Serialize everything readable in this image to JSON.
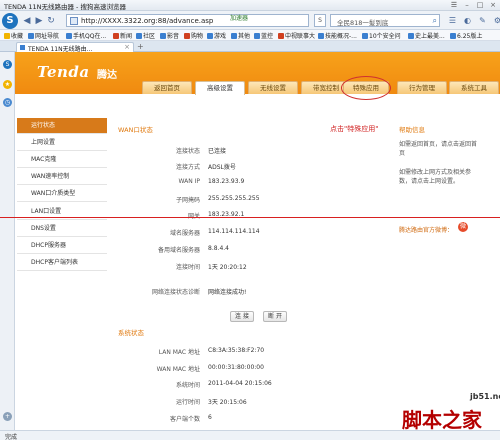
{
  "window": {
    "title": "TENDA 11N无线路由器 - 搜狗高速浏览器"
  },
  "address": {
    "url": "http://XXXX.3322.org:88/advance.asp",
    "accel_label": "加速器",
    "search_value": "全民818一髪到底"
  },
  "favorites": [
    {
      "label": "收藏",
      "color": "#f1b400"
    },
    {
      "label": "网址导航",
      "color": "#3a7fd0"
    },
    {
      "label": "手机QQ在...",
      "color": "#3a7fd0"
    },
    {
      "label": "新闻",
      "color": "#d04020"
    },
    {
      "label": "社区",
      "color": "#3a7fd0"
    },
    {
      "label": "影音",
      "color": "#3a7fd0"
    },
    {
      "label": "购物",
      "color": "#d04020"
    },
    {
      "label": "游戏",
      "color": "#3a7fd0"
    },
    {
      "label": "其他",
      "color": "#3a7fd0"
    },
    {
      "label": "蓝控",
      "color": "#3a7fd0"
    },
    {
      "label": "中视联事大",
      "color": "#d04020"
    },
    {
      "label": "技能概况-...",
      "color": "#3a7fd0"
    },
    {
      "label": "10个安全问",
      "color": "#3a7fd0"
    },
    {
      "label": "史上最美...",
      "color": "#3a7fd0"
    },
    {
      "label": "6.25版上",
      "color": "#3a7fd0"
    }
  ],
  "tab": {
    "label": "TENDA 11N无线路由..."
  },
  "status": {
    "text": "完成"
  },
  "router": {
    "brand": "Tenda",
    "brand_cn": "腾达",
    "tabs": [
      {
        "label": "返回首页",
        "active": false
      },
      {
        "label": "高级设置",
        "active": true
      },
      {
        "label": "无线设置",
        "active": false
      },
      {
        "label": "带宽控制",
        "active": false
      },
      {
        "label": "特殊应用",
        "active": false
      },
      {
        "label": "行为管理",
        "active": false
      },
      {
        "label": "系统工具",
        "active": false
      }
    ],
    "left_nav": [
      {
        "label": "运行状态",
        "active": true
      },
      {
        "label": "上网设置",
        "active": false
      },
      {
        "label": "MAC克隆",
        "active": false
      },
      {
        "label": "WAN速率控制",
        "active": false
      },
      {
        "label": "WAN口介质类型",
        "active": false
      },
      {
        "label": "LAN口设置",
        "active": false
      },
      {
        "label": "DNS设置",
        "active": false
      },
      {
        "label": "DHCP服务器",
        "active": false
      },
      {
        "label": "DHCP客户端列表",
        "active": false
      }
    ],
    "annotation": "点击\"特殊应用\"",
    "wan": {
      "title": "WAN口状态",
      "rows": [
        {
          "label": "连接状态",
          "value": "已连接"
        },
        {
          "label": "连接方式",
          "value": "ADSL拨号"
        },
        {
          "label": "WAN IP",
          "value": "183.23.93.9"
        },
        {
          "label": "子网掩码",
          "value": "255.255.255.255"
        },
        {
          "label": "网关",
          "value": "183.23.92.1"
        },
        {
          "label": "域名服务器",
          "value": "114.114.114.114"
        },
        {
          "label": "备用域名服务器",
          "value": "8.8.4.4"
        },
        {
          "label": "连接时间",
          "value": "1天 20:20:12"
        },
        {
          "label": "网络连接状态诊断",
          "value": "网络连接成功!"
        }
      ],
      "connect_btn": "连 接",
      "disconnect_btn": "断 开"
    },
    "system": {
      "title": "系统状态",
      "rows": [
        {
          "label": "LAN MAC 地址",
          "value": "C8:3A:35:38:F2:70"
        },
        {
          "label": "WAN MAC 地址",
          "value": "00:00:31:80:00:00"
        },
        {
          "label": "系统时间",
          "value": "2011-04-04 20:15:06"
        },
        {
          "label": "运行时间",
          "value": "3天 20:15:06"
        },
        {
          "label": "客户端个数",
          "value": "6"
        }
      ]
    },
    "help": {
      "title": "帮助信息",
      "p1": "如需返回首页，请点击返回首页",
      "p2": "如需修改上网方式及相关参数，请点击上网设置。",
      "weibo": "腾达路由官方微博："
    }
  },
  "watermark": {
    "site": "jb51.net",
    "name": "脚本之家"
  }
}
